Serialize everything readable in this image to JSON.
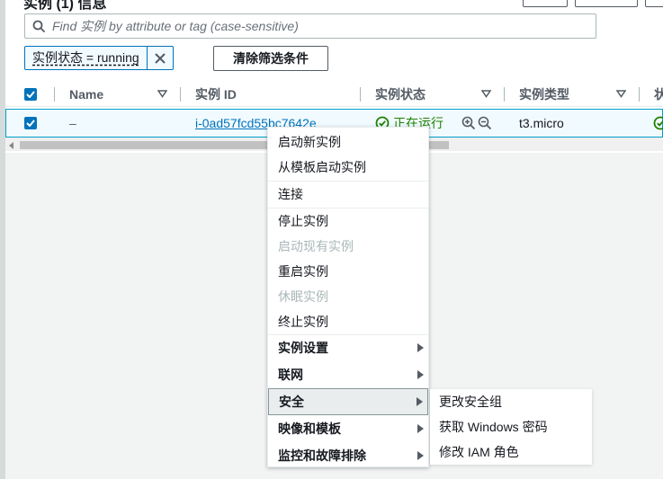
{
  "header": {
    "title_partial": "实例 (1) 信息"
  },
  "search": {
    "placeholder": "Find 实例 by attribute or tag (case-sensitive)"
  },
  "filter": {
    "token_label": "实例状态 = running",
    "clear_label": "清除筛选条件"
  },
  "table": {
    "columns": [
      "Name",
      "实例 ID",
      "实例状态",
      "实例类型",
      "状"
    ],
    "row": {
      "name": "–",
      "instance_id": "i-0ad57fcd55bc7642e",
      "state": "正在运行",
      "type": "t3.micro",
      "selected": true
    }
  },
  "context_menu": {
    "items": [
      {
        "label": "启动新实例",
        "enabled": true,
        "submenu": false
      },
      {
        "label": "从模板启动实例",
        "enabled": true,
        "submenu": false
      },
      {
        "label": "连接",
        "enabled": true,
        "submenu": false
      },
      {
        "label": "停止实例",
        "enabled": true,
        "submenu": false
      },
      {
        "label": "启动现有实例",
        "enabled": false,
        "submenu": false
      },
      {
        "label": "重启实例",
        "enabled": true,
        "submenu": false
      },
      {
        "label": "休眠实例",
        "enabled": false,
        "submenu": false
      },
      {
        "label": "终止实例",
        "enabled": true,
        "submenu": false
      },
      {
        "label": "实例设置",
        "enabled": true,
        "submenu": true
      },
      {
        "label": "联网",
        "enabled": true,
        "submenu": true
      },
      {
        "label": "安全",
        "enabled": true,
        "submenu": true,
        "active": true
      },
      {
        "label": "映像和模板",
        "enabled": true,
        "submenu": true
      },
      {
        "label": "监控和故障排除",
        "enabled": true,
        "submenu": true
      }
    ]
  },
  "security_submenu": {
    "items": [
      "更改安全组",
      "获取 Windows 密码",
      "修改 IAM 角色"
    ]
  },
  "colors": {
    "accent": "#0073bb",
    "success": "#1d8102",
    "disabled": "#aab7b8"
  },
  "icons": {
    "search": "search-icon",
    "close": "close-icon",
    "status": "check-circle-icon",
    "zoom_in": "zoom-in-icon",
    "zoom_out": "zoom-out-icon"
  }
}
